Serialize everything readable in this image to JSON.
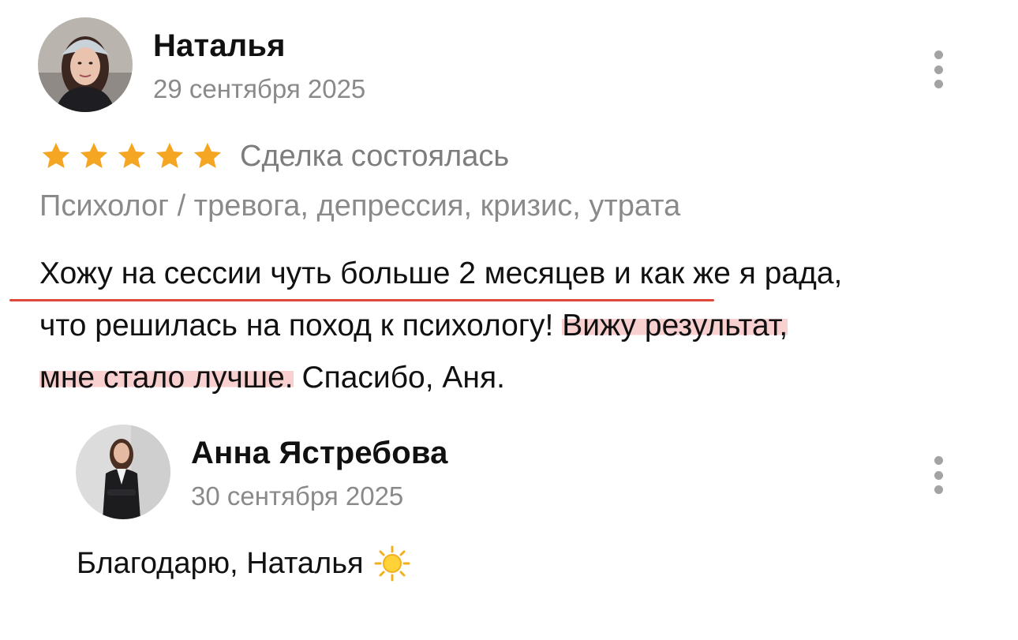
{
  "review": {
    "author": "Наталья",
    "date": "29 сентября 2025",
    "rating": 5,
    "rating_max": 5,
    "status": "Сделка состоялась",
    "category": "Психолог / тревога, депрессия, кризис, утрата",
    "text_lines": [
      {
        "plain": "Хожу на сессии чуть больше 2 месяцев и как же я рада,"
      },
      {
        "plain": "что решилась на поход к психологу! ",
        "highlight": "Вижу результат,"
      },
      {
        "highlight": "мне стало лучше.",
        "plain": " Спасибо, Аня."
      }
    ],
    "avatar_icon": "user-photo",
    "menu_icon": "more-vertical-icon"
  },
  "reply": {
    "author": "Анна Ястребова",
    "date": "30 сентября 2025",
    "text": "Благодарю, Наталья",
    "emoji_icon": "sun-icon",
    "avatar_icon": "user-photo",
    "menu_icon": "more-vertical-icon"
  },
  "colors": {
    "star": "#f5a623",
    "highlight": "#f3b3b3",
    "underline": "#e0463a",
    "muted_text": "#8a8a8a",
    "menu_dots": "#a3a3a3"
  }
}
